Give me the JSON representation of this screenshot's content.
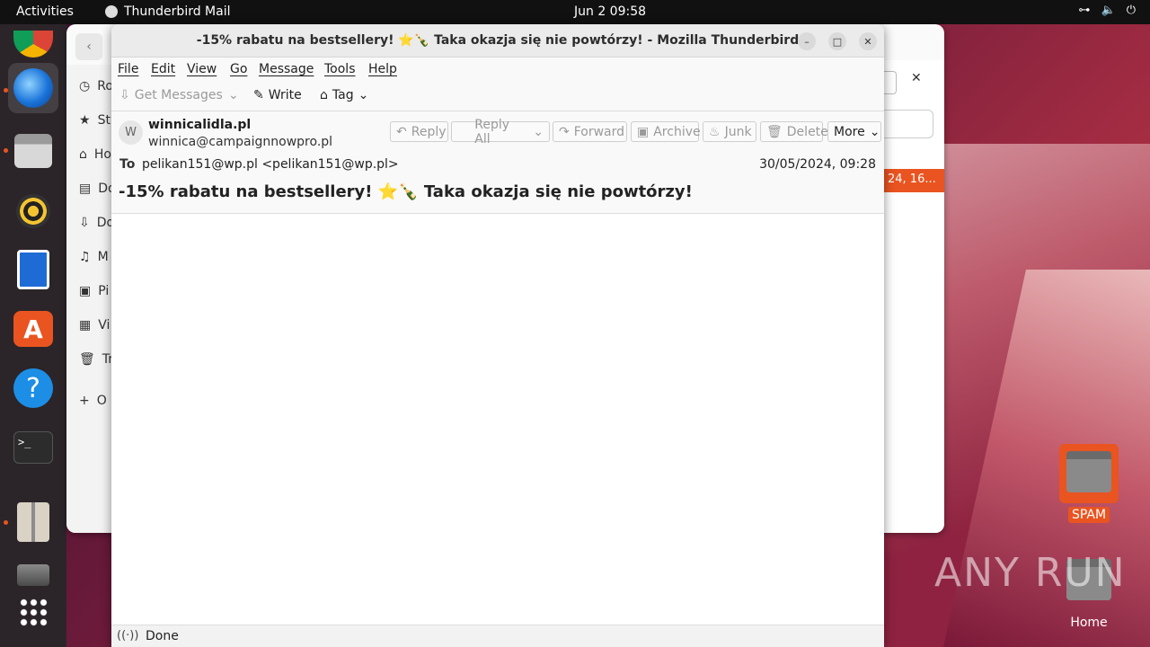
{
  "topbar": {
    "activities": "Activities",
    "app_name": "Thunderbird Mail",
    "clock": "Jun 2  09:58",
    "network_icon": "network-icon",
    "volume_icon": "volume-icon",
    "power_icon": "power-icon"
  },
  "dock": {
    "items": [
      {
        "name": "chrome",
        "icon": "chrome-icon"
      },
      {
        "name": "thunderbird",
        "icon": "thunderbird-icon"
      },
      {
        "name": "files",
        "icon": "files-icon"
      },
      {
        "name": "rhythmbox",
        "icon": "rhythmbox-icon"
      },
      {
        "name": "writer",
        "icon": "writer-icon"
      },
      {
        "name": "app-center",
        "icon": "app-center-icon"
      },
      {
        "name": "help",
        "icon": "help-icon"
      },
      {
        "name": "terminal",
        "icon": "terminal-icon"
      },
      {
        "name": "archive",
        "icon": "archive-icon"
      },
      {
        "name": "drive",
        "icon": "drive-icon"
      },
      {
        "name": "show-apps",
        "icon": "grid-icon"
      }
    ]
  },
  "file_manager": {
    "sidebar": [
      "Ro",
      "St",
      "Ho",
      "Do",
      "Do",
      "M",
      "Pi",
      "Vi",
      "Tr",
      "O"
    ],
    "selected_row_text": "24, 16..."
  },
  "window": {
    "title": "-15% rabatu na bestsellery! ⭐🍾 Taka okazja się nie powtórzy! - Mozilla Thunderbird"
  },
  "menubar": {
    "items": [
      "File",
      "Edit",
      "View",
      "Go",
      "Message",
      "Tools",
      "Help"
    ]
  },
  "toolbar": {
    "get_messages": "Get Messages",
    "write": "Write",
    "tag": "Tag"
  },
  "message": {
    "avatar_letter": "W",
    "from_name": "winnicalidla.pl",
    "from_address": "winnica@campaignnowpro.pl",
    "to_label": "To",
    "to_value": "pelikan151@wp.pl <pelikan151@wp.pl>",
    "date": "30/05/2024, 09:28",
    "subject": "-15% rabatu na bestsellery! ⭐🍾 Taka okazja się nie powtórzy!",
    "buttons": {
      "reply": "Reply",
      "reply_all": "Reply All",
      "forward": "Forward",
      "archive": "Archive",
      "junk": "Junk",
      "delete": "Delete",
      "more": "More"
    }
  },
  "status": {
    "text": "Done"
  },
  "desktop": {
    "icons": [
      {
        "label": "SPAM"
      },
      {
        "label": "Home"
      }
    ]
  },
  "watermark": "ANY RUN",
  "colors": {
    "accent": "#e95420",
    "topbar": "#111111",
    "dock": "#2b2529"
  }
}
